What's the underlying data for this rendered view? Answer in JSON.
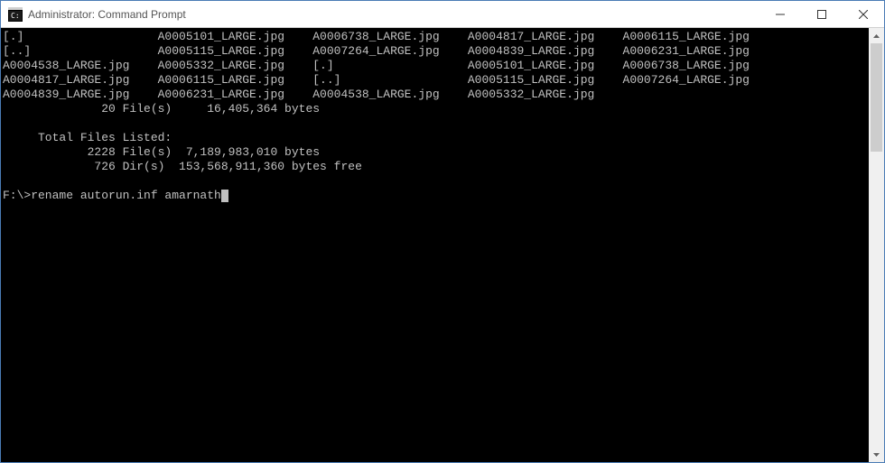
{
  "window": {
    "title": "Administrator: Command Prompt"
  },
  "terminal": {
    "col_gap": "   ",
    "rows": [
      [
        "[.]                ",
        "A0005101_LARGE.jpg ",
        "A0006738_LARGE.jpg ",
        "A0004817_LARGE.jpg ",
        "A0006115_LARGE.jpg"
      ],
      [
        "[..]               ",
        "A0005115_LARGE.jpg ",
        "A0007264_LARGE.jpg ",
        "A0004839_LARGE.jpg ",
        "A0006231_LARGE.jpg"
      ],
      [
        "A0004538_LARGE.jpg ",
        "A0005332_LARGE.jpg ",
        "[.]                ",
        "A0005101_LARGE.jpg ",
        "A0006738_LARGE.jpg"
      ],
      [
        "A0004817_LARGE.jpg ",
        "A0006115_LARGE.jpg ",
        "[..]               ",
        "A0005115_LARGE.jpg ",
        "A0007264_LARGE.jpg"
      ],
      [
        "A0004839_LARGE.jpg ",
        "A0006231_LARGE.jpg ",
        "A0004538_LARGE.jpg ",
        "A0005332_LARGE.jpg"
      ]
    ],
    "summary1": "              20 File(s)     16,405,364 bytes",
    "blank": "",
    "summary_header": "     Total Files Listed:",
    "summary2": "            2228 File(s)  7,189,983,010 bytes",
    "summary3": "             726 Dir(s)  153,568,911,360 bytes free",
    "prompt_line": "F:\\>rename autorun.inf amarnath"
  }
}
